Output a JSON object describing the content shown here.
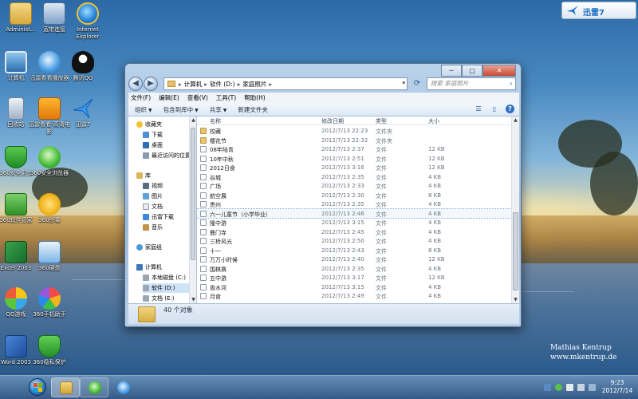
{
  "desktop": {
    "icons": [
      {
        "label": "Administ...",
        "icon": "user-folder-icon"
      },
      {
        "label": "宽带连接",
        "icon": "network-connection-icon"
      },
      {
        "label": "Internet Explorer",
        "icon": "internet-explorer-icon"
      },
      {
        "label": "计算机",
        "icon": "computer-icon"
      },
      {
        "label": "迅雷看看播放器",
        "icon": "xunlei-player-icon"
      },
      {
        "label": "腾讯QQ",
        "icon": "qq-penguin-icon"
      },
      {
        "label": "回收站",
        "icon": "recycle-bin-icon"
      },
      {
        "label": "迅雷看看-高清电影",
        "icon": "xunlei-kankan-hd-icon"
      },
      {
        "label": "迅雷7",
        "icon": "xunlei7-icon"
      },
      {
        "label": "360安全卫士",
        "icon": "360-safe-icon"
      },
      {
        "label": "360安全浏览器",
        "icon": "360-browser-icon"
      },
      {
        "label": "360软件管家",
        "icon": "360-software-manager-icon"
      },
      {
        "label": "360杀毒",
        "icon": "360-antivirus-icon"
      },
      {
        "label": "Excel 2003",
        "icon": "excel-icon"
      },
      {
        "label": "360硬盘",
        "icon": "360-disk-icon"
      },
      {
        "label": "QQ游戏",
        "icon": "qq-game-icon"
      },
      {
        "label": "360手机助手",
        "icon": "360-mobile-icon"
      },
      {
        "label": "Word 2003",
        "icon": "word-icon"
      },
      {
        "label": "360隐私保护",
        "icon": "360-privacy-icon"
      }
    ],
    "watermark": {
      "line1": "Mathias Kentrup",
      "line2": "www.mkentrup.de"
    },
    "xunlei_widget": {
      "label": "迅雷7"
    }
  },
  "explorer": {
    "caption": {
      "minimize": "─",
      "maximize": "□",
      "close": "✕"
    },
    "address": {
      "crumbs": [
        "计算机",
        "软件 (D:)",
        "家庭照片"
      ],
      "separator": "▸",
      "search_placeholder": "搜索 家庭照片"
    },
    "menu": [
      "文件(F)",
      "编辑(E)",
      "查看(V)",
      "工具(T)",
      "帮助(H)"
    ],
    "toolbar": {
      "organize": "组织",
      "include": "包含到库中",
      "share": "共享",
      "new_folder": "新建文件夹"
    },
    "nav": {
      "favorites": "收藏夹",
      "downloads": "下载",
      "desktop": "桌面",
      "recent": "最近访问的位置",
      "libraries": "库",
      "videos": "视频",
      "pictures": "图片",
      "documents": "文档",
      "xunlei_downloads": "迅雷下载",
      "music": "音乐",
      "homegroup": "家庭组",
      "computer": "计算机",
      "local_disk": "本地磁盘 (C:)",
      "software_disk": "软件 (D:)",
      "documents_disk": "文档 (E:)"
    },
    "columns": {
      "name": "名称",
      "date": "修改日期",
      "type": "类型",
      "size": "大小"
    },
    "files": [
      {
        "name": "校藏",
        "date": "2012/7/13 22:23",
        "type": "文件夹",
        "size": "",
        "kind": "folder"
      },
      {
        "name": "樱花节",
        "date": "2012/7/13 22:32",
        "type": "文件夹",
        "size": "",
        "kind": "folder"
      },
      {
        "name": "08年陆青",
        "date": "2012/7/13 2:37",
        "type": "文件",
        "size": "12 KB",
        "kind": "file"
      },
      {
        "name": "10年中秋",
        "date": "2012/7/13 2:51",
        "type": "文件",
        "size": "12 KB",
        "kind": "file"
      },
      {
        "name": "2012日食",
        "date": "2012/7/13 3:16",
        "type": "文件",
        "size": "12 KB",
        "kind": "file"
      },
      {
        "name": "谷城",
        "date": "2012/7/13 2:35",
        "type": "文件",
        "size": "4 KB",
        "kind": "file"
      },
      {
        "name": "广场",
        "date": "2012/7/13 2:33",
        "type": "文件",
        "size": "4 KB",
        "kind": "file"
      },
      {
        "name": "航空展",
        "date": "2012/7/13 2:30",
        "type": "文件",
        "size": "8 KB",
        "kind": "file"
      },
      {
        "name": "贵州",
        "date": "2012/7/13 2:35",
        "type": "文件",
        "size": "4 KB",
        "kind": "file"
      },
      {
        "name": "六一儿童节（小学毕业）",
        "date": "2012/7/13 2:46",
        "type": "文件",
        "size": "4 KB",
        "kind": "file",
        "focused": true
      },
      {
        "name": "隆中游",
        "date": "2012/7/13 3:15",
        "type": "文件",
        "size": "4 KB",
        "kind": "file"
      },
      {
        "name": "鹿门寺",
        "date": "2012/7/13 2:45",
        "type": "文件",
        "size": "4 KB",
        "kind": "file"
      },
      {
        "name": "三桥风光",
        "date": "2012/7/13 2:50",
        "type": "文件",
        "size": "4 KB",
        "kind": "file"
      },
      {
        "name": "十一",
        "date": "2012/7/13 2:43",
        "type": "文件",
        "size": "8 KB",
        "kind": "file"
      },
      {
        "name": "万万小时候",
        "date": "2012/7/13 2:40",
        "type": "文件",
        "size": "12 KB",
        "kind": "file"
      },
      {
        "name": "围棋赛",
        "date": "2012/7/13 2:35",
        "type": "文件",
        "size": "4 KB",
        "kind": "file"
      },
      {
        "name": "五中游",
        "date": "2012/7/13 3:17",
        "type": "文件",
        "size": "12 KB",
        "kind": "file"
      },
      {
        "name": "香水河",
        "date": "2012/7/13 3:15",
        "type": "文件",
        "size": "4 KB",
        "kind": "file"
      },
      {
        "name": "月食",
        "date": "2012/7/13 2:49",
        "type": "文件",
        "size": "4 KB",
        "kind": "file"
      }
    ],
    "status": {
      "count": "40 个对象"
    }
  },
  "taskbar": {
    "items": [
      {
        "icon": "explorer-folder-icon",
        "active": true
      },
      {
        "icon": "360-browser-icon",
        "active": false
      }
    ],
    "clock": {
      "time": "9:23",
      "date": "2012/7/14"
    }
  },
  "colors": {
    "accent": "#1a6fc7",
    "window_frame": "#9dbbdc",
    "taskbar": "#375a87"
  }
}
